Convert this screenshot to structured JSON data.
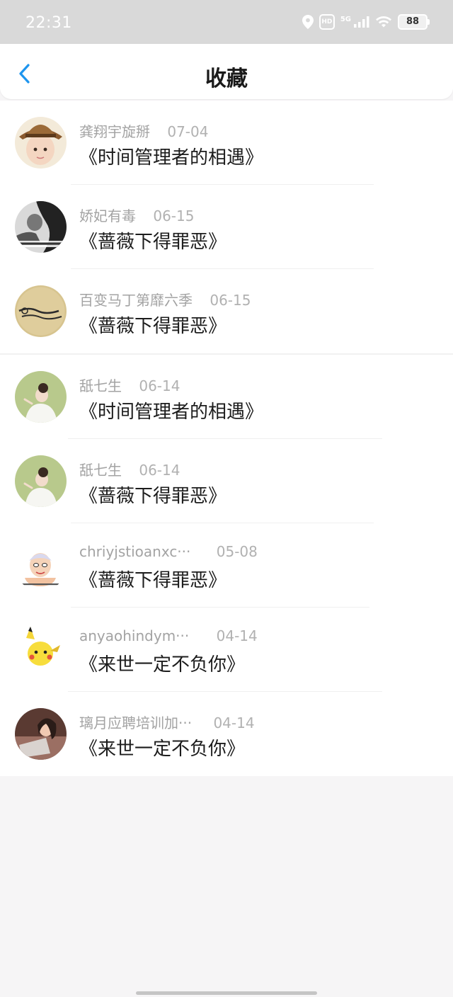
{
  "status": {
    "time": "22:31",
    "hd_label": "HD",
    "network_label": "5G",
    "battery": "88",
    "icons": [
      "location-icon",
      "hd-icon",
      "signal-icon",
      "wifi-icon",
      "battery-icon"
    ]
  },
  "header": {
    "title": "收藏",
    "back_icon": "chevron-left-icon",
    "accent_color": "#1e95ee"
  },
  "favorites": [
    {
      "name": "龚翔宇旋掰",
      "date": "07-04",
      "title": "《时间管理者的相遇》"
    },
    {
      "name": "娇妃有毒",
      "date": "06-15",
      "title": "《蔷薇下得罪恶》"
    },
    {
      "name": "百变马丁第靡六季",
      "date": "06-15",
      "title": "《蔷薇下得罪恶》"
    },
    {
      "name": "舐七生",
      "date": "06-14",
      "title": "《时间管理者的相遇》"
    },
    {
      "name": "舐七生",
      "date": "06-14",
      "title": "《蔷薇下得罪恶》"
    },
    {
      "name": "chriyjstioanxc···",
      "date": "05-08",
      "title": "《蔷薇下得罪恶》"
    },
    {
      "name": "anyaohindym···",
      "date": "04-14",
      "title": "《来世一定不负你》"
    },
    {
      "name": "璃月应聘培训加···",
      "date": "04-14",
      "title": "《来世一定不负你》"
    }
  ]
}
